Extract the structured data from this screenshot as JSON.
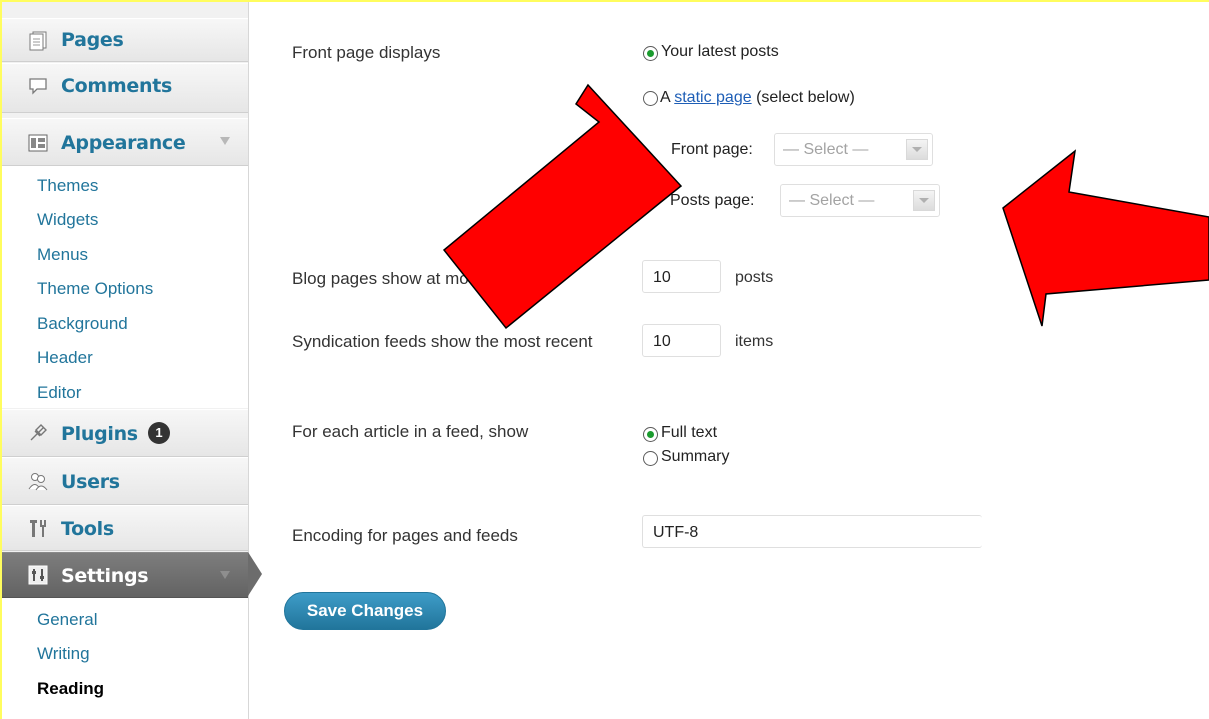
{
  "sidebar": {
    "pages": "Pages",
    "comments": "Comments",
    "appearance": "Appearance",
    "appearance_sub": [
      "Themes",
      "Widgets",
      "Menus",
      "Theme Options",
      "Background",
      "Header",
      "Editor"
    ],
    "plugins": "Plugins",
    "plugins_badge": "1",
    "users": "Users",
    "tools": "Tools",
    "settings": "Settings",
    "settings_sub": [
      "General",
      "Writing",
      "Reading"
    ]
  },
  "reading": {
    "front_page_displays": {
      "label": "Front page displays",
      "opt_latest": "Your latest posts",
      "opt_static_prefix": "A ",
      "opt_static_link": "static page",
      "opt_static_suffix": " (select below)",
      "front_page_label": "Front page:",
      "posts_page_label": "Posts page:",
      "select_placeholder": "— Select —",
      "selected": "latest"
    },
    "blog_pages": {
      "label": "Blog pages show at most",
      "value": "10",
      "suffix": "posts"
    },
    "syndication": {
      "label": "Syndication feeds show the most recent",
      "value": "10",
      "suffix": "items"
    },
    "feed_article": {
      "label": "For each article in a feed, show",
      "opt_full": "Full text",
      "opt_summary": "Summary",
      "selected": "full"
    },
    "encoding": {
      "label": "Encoding for pages and feeds",
      "value": "UTF-8"
    },
    "save_label": "Save Changes"
  },
  "colors": {
    "link": "#21759b",
    "annotation_arrow": "#ff0000",
    "annotation_border": "#fffd5e"
  }
}
